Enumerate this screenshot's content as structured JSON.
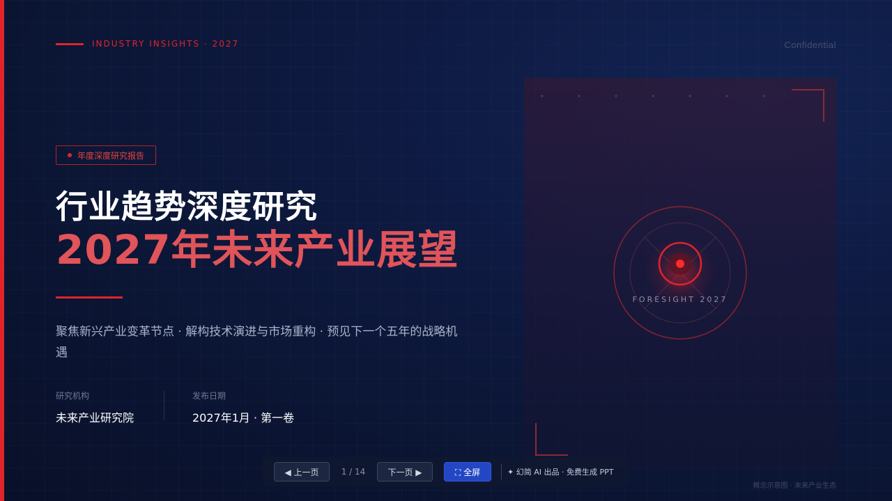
{
  "header": {
    "brand": "INDUSTRY INSIGHTS · 2027",
    "confidential": "Confidential"
  },
  "hero": {
    "tag": "年度深度研究报告",
    "title_line1": "行业趋势深度研究",
    "title_line2": "2027年未来产业展望",
    "subtitle": "聚焦新兴产业变革节点 · 解构技术演进与市场重构 · 预见下一个五年的战略机遇"
  },
  "meta": {
    "org_label": "研究机构",
    "org_value": "未来产业研究院",
    "date_label": "发布日期",
    "date_value": "2027年1月 · 第一卷"
  },
  "visual": {
    "caption": "FORESIGHT 2027",
    "footnote": "概念示意图 · 未来产业生态"
  },
  "controls": {
    "prev_label": "◀ 上一页",
    "page_counter": "1 / 14",
    "next_label": "下一页 ▶",
    "fullscreen_label": "⛶ 全屏",
    "brand_note": "✦ 幻简 AI 出品 · 免费生成 PPT"
  },
  "colors": {
    "accent": "#e0242a",
    "title_red": "#e0545a",
    "background": "#0b1533",
    "button_blue": "#2347c4"
  }
}
